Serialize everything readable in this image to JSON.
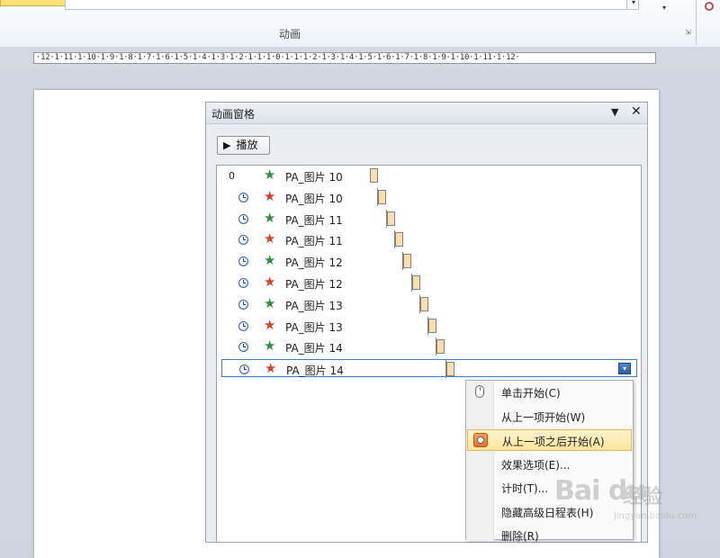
{
  "ribbon": {
    "group_label": "动画",
    "dropdown_glyph": "▾",
    "more_glyph": "▾",
    "launcher_glyph": "⇲"
  },
  "ruler": {
    "text": "·12·1·11·1·10·1·9·1·8·1·7·1·6·1·5·1·4·1·3·1·2·1·1·1·0·1·1·1·2·1·3·1·4·1·5·1·6·1·7·1·8·1·9·1·10·1·11·1·12·"
  },
  "pane": {
    "title": "动画窗格",
    "menu_glyph": "▼",
    "close_glyph": "✕",
    "play_label": "播放",
    "play_glyph": "▶"
  },
  "items": [
    {
      "num": "0",
      "trigger": "none",
      "effect": "enter",
      "name": "PA_图片 10"
    },
    {
      "num": "",
      "trigger": "clock",
      "effect": "exit",
      "name": "PA_图片 10"
    },
    {
      "num": "",
      "trigger": "clock",
      "effect": "enter",
      "name": "PA_图片 11"
    },
    {
      "num": "",
      "trigger": "clock",
      "effect": "exit",
      "name": "PA_图片 11"
    },
    {
      "num": "",
      "trigger": "clock",
      "effect": "enter",
      "name": "PA_图片 12"
    },
    {
      "num": "",
      "trigger": "clock",
      "effect": "exit",
      "name": "PA_图片 12"
    },
    {
      "num": "",
      "trigger": "clock",
      "effect": "enter",
      "name": "PA_图片 13"
    },
    {
      "num": "",
      "trigger": "clock",
      "effect": "exit",
      "name": "PA_图片 13"
    },
    {
      "num": "",
      "trigger": "clock",
      "effect": "enter",
      "name": "PA_图片 14"
    },
    {
      "num": "",
      "trigger": "clock",
      "effect": "exit",
      "name": "PA_图片 14",
      "selected": true
    }
  ],
  "row_dropdown_glyph": "▾",
  "star_glyph": "★",
  "context_menu": {
    "items": [
      {
        "label": "单击开始(C)",
        "icon": "mouse-icon"
      },
      {
        "label": "从上一项开始(W)",
        "icon": ""
      },
      {
        "label": "从上一项之后开始(A)",
        "icon": "clock-icon",
        "highlighted": true
      },
      {
        "label": "效果选项(E)...",
        "icon": ""
      },
      {
        "label": "计时(T)...",
        "icon": ""
      },
      {
        "label": "隐藏高级日程表(H)",
        "icon": ""
      },
      {
        "label": "删除(R)",
        "icon": ""
      }
    ]
  },
  "watermark": {
    "logo": "Bai du",
    "sub": "经验",
    "url": "jingyan.baidu.com"
  },
  "colors": {
    "enter_star": "#2f8f3f",
    "exit_star": "#d8402c",
    "selection_border": "#3d7dc8",
    "menu_highlight": "#fde59a",
    "timebar": "#f9dfb0"
  }
}
